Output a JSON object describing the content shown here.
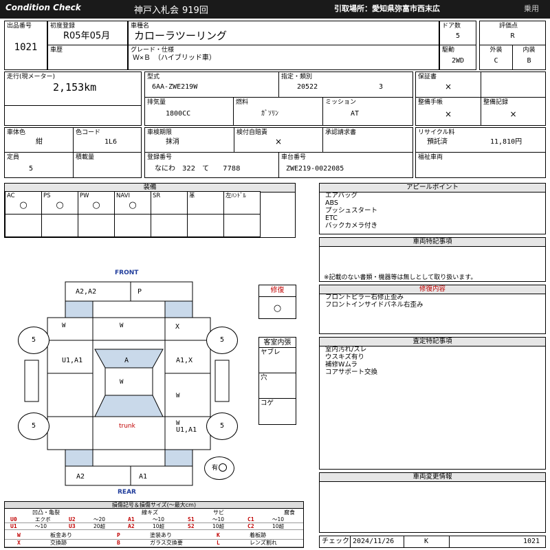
{
  "header": {
    "title": "Condition Check",
    "auction": "神戸入札会",
    "session": "919回",
    "pickup_label": "引取場所：愛知県弥富市西末広",
    "category": "乗用"
  },
  "vehicle": {
    "lot_label": "出品番号",
    "lot": "1021",
    "reg_label": "初度登録",
    "reg": "R05年05月",
    "history_label": "車歴",
    "name_label": "車種名",
    "name": "カローラツーリング",
    "grade_label": "グレード・仕様",
    "grade": "Ｗ×Ｂ　（ハイブリッド車）",
    "doors_label": "ドア数",
    "doors": "5",
    "score_label": "評価点",
    "score": "R",
    "drive_label": "駆動",
    "drive": "2WD",
    "ext_label": "外装",
    "ext": "C",
    "int_label": "内装",
    "int": "B",
    "mileage_label": "走行(現メーター)",
    "mileage": "2,153km",
    "model_label": "型式",
    "model": "6AA-ZWE219W",
    "designation_label": "指定・類別",
    "designation": "20522",
    "class_no": "3",
    "displacement_label": "排気量",
    "displacement": "1800CC",
    "fuel_label": "燃料",
    "fuel": "ｶﾞｿﾘﾝ",
    "mission_label": "ミッション",
    "mission": "AT",
    "warranty_label": "保証書",
    "warranty": "×",
    "manual_label": "整備手帳",
    "manual": "×",
    "record_label": "整備記録",
    "record": "×",
    "color_label": "車体色",
    "color": "紺",
    "color_code_label": "色コード",
    "color_code": "1L6",
    "inspection_label": "車検期限",
    "inspection": "抹消",
    "insurance_label": "検付自賠責",
    "insurance": "×",
    "approval_label": "承認請求書",
    "recycle_label": "リサイクル料",
    "recycle_status": "預託済",
    "recycle_fee": "11,810円",
    "capacity_label": "定員",
    "capacity": "5",
    "load_label": "積載量",
    "plate_label": "登録番号",
    "plate": "なにわ　322　て　　7788",
    "chassis_label": "車台番号",
    "chassis": "ZWE219-0022085",
    "welfare_label": "福祉車両"
  },
  "equipment": {
    "title": "装備",
    "cols": [
      {
        "label": "AC",
        "val": "○"
      },
      {
        "label": "PS",
        "val": "○"
      },
      {
        "label": "PW",
        "val": "○"
      },
      {
        "label": "NAVI",
        "val": "○"
      },
      {
        "label": "SR",
        "val": ""
      },
      {
        "label": "革",
        "val": ""
      },
      {
        "label": "左ﾊﾝﾄﾞﾙ",
        "val": ""
      }
    ]
  },
  "appeal": {
    "title": "アピールポイント",
    "lines": [
      "エアバッグ",
      "ABS",
      "プッシュスタート",
      "ETC",
      "バックカメラ付き"
    ]
  },
  "special": {
    "title": "車両特記事項",
    "note": "※記載のない書類・機器等は無しとして取り扱います。"
  },
  "repair": {
    "title": "修復",
    "value": "○"
  },
  "repair_content": {
    "title": "修復内容",
    "lines": [
      "フロントピラー右修正歪み",
      "フロントインサイドパネル右歪み"
    ]
  },
  "cabin": {
    "title": "客室内張",
    "items": [
      "ヤブレ",
      "穴",
      "コゲ"
    ]
  },
  "assessment": {
    "title": "査定特記事項",
    "lines": [
      "室内汚れ/スレ",
      "ウスキズ有り",
      "補修Wムラ",
      "コアサポート交換"
    ]
  },
  "changes": {
    "title": "車両変更情報"
  },
  "check": {
    "label": "チェック",
    "date": "2024/11/26",
    "code": "K",
    "lot": "1021"
  },
  "diagram": {
    "front": "FRONT",
    "rear": "REAR",
    "trunk": "trunk",
    "tires": [
      "5",
      "5",
      "5",
      "5"
    ],
    "marks": {
      "front_a": "A2,A2",
      "front_p": "P",
      "fender_r": "X",
      "door_fl": "U1,A1",
      "roof": "A",
      "door_fr": "A1,X",
      "rear_fr": "U1,A1",
      "rear_l": "A2",
      "rear_r": "A1",
      "badge": "有",
      "w": "W"
    }
  },
  "legend": {
    "title": "損傷記号＆損傷サイズ(〜最大cm)",
    "headers": [
      "凹凸・亀裂",
      "線キズ",
      "サビ",
      "腐食"
    ],
    "r1": [
      {
        "c": "U0",
        "t": "エクボ"
      },
      {
        "c": "U2",
        "t": "〜20"
      },
      {
        "c": "A1",
        "t": "〜10"
      },
      {
        "c": "S1",
        "t": "〜10"
      },
      {
        "c": "C1",
        "t": "〜10"
      }
    ],
    "r2": [
      {
        "c": "U1",
        "t": "〜10"
      },
      {
        "c": "U3",
        "t": "20超"
      },
      {
        "c": "A2",
        "t": "10超"
      },
      {
        "c": "S2",
        "t": "10超"
      },
      {
        "c": "C2",
        "t": "10超"
      }
    ],
    "r3": [
      {
        "c": "W",
        "t": "板金あり"
      },
      {
        "c": "P",
        "t": "塗装あり"
      },
      {
        "c": "K",
        "t": "着板跡"
      }
    ],
    "r4": [
      {
        "c": "X",
        "t": "交換跡"
      },
      {
        "c": "B",
        "t": "ガラス交換要"
      },
      {
        "c": "L",
        "t": "レンズ割れ"
      }
    ]
  },
  "colors": {
    "header_bg": "#1a1a1a",
    "accent_red": "#c00000",
    "panel_blue": "#c9d9ea",
    "title_gray": "#e6e6e6",
    "front_rear": "#1f3c9b"
  }
}
